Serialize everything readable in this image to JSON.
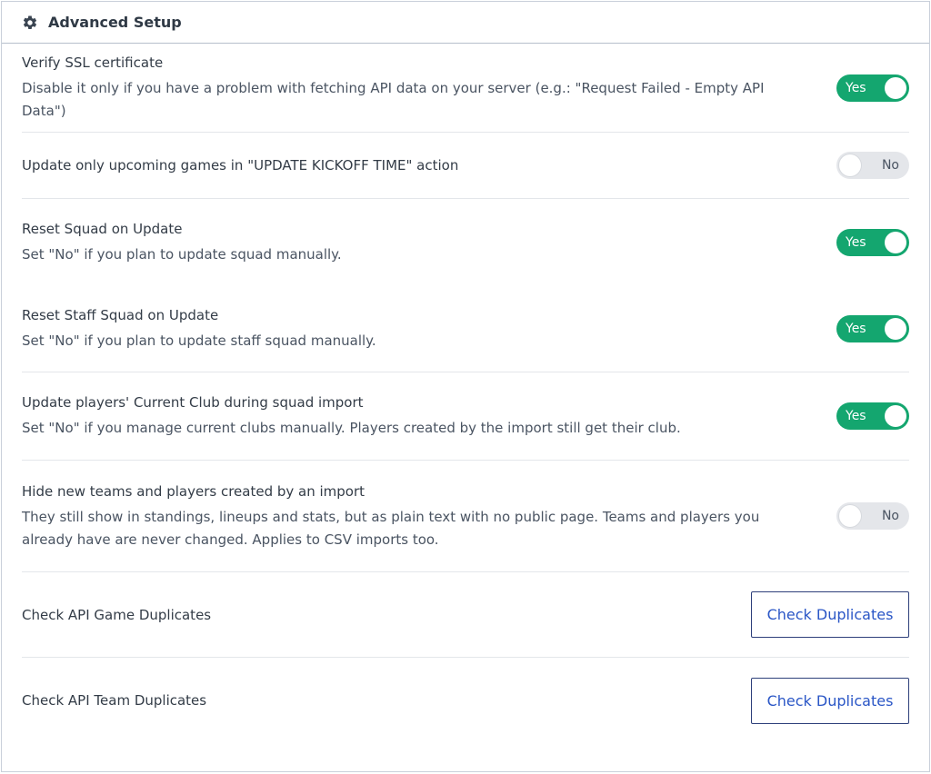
{
  "header": {
    "title": "Advanced Setup",
    "icon": "gear-icon"
  },
  "colors": {
    "toggle_on": "#14a66f",
    "toggle_off": "#e4e6ea",
    "button_text": "#2a56c6"
  },
  "settings": [
    {
      "label": "Verify SSL certificate",
      "description": "Disable it only if you have a problem with fetching API data on your server (e.g.: \"Request Failed - Empty API Data\")",
      "state": "Yes"
    },
    {
      "label": "Update only upcoming games in \"UPDATE KICKOFF TIME\" action",
      "state": "No"
    },
    {
      "label": "Reset Squad on Update",
      "description": "Set \"No\" if you plan to update squad manually.",
      "state": "Yes"
    },
    {
      "label": "Reset Staff Squad on Update",
      "description": "Set \"No\" if you plan to update staff squad manually.",
      "state": "Yes"
    },
    {
      "label": "Update players' Current Club during squad import",
      "description": "Set \"No\" if you manage current clubs manually. Players created by the import still get their club.",
      "state": "Yes"
    },
    {
      "label": "Hide new teams and players created by an import",
      "description": "They still show in standings, lineups and stats, but as plain text with no public page. Teams and players you already have are never changed. Applies to CSV imports too.",
      "state": "No"
    }
  ],
  "actions": [
    {
      "label": "Check API Game Duplicates",
      "button": "Check Duplicates"
    },
    {
      "label": "Check API Team Duplicates",
      "button": "Check Duplicates"
    }
  ]
}
